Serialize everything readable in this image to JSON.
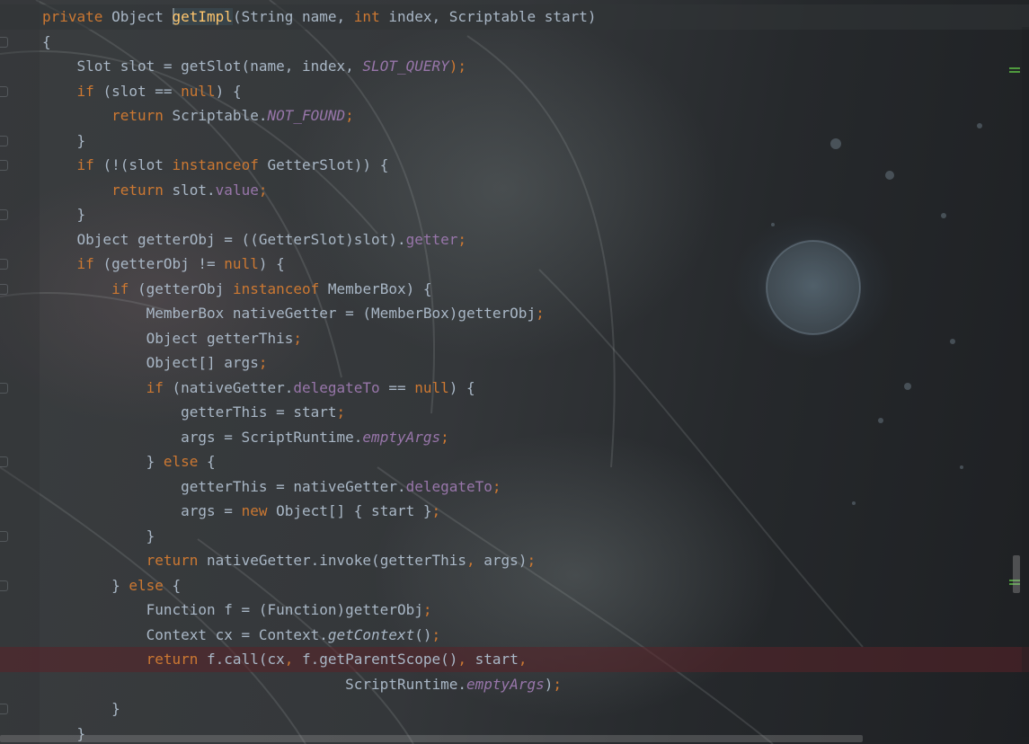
{
  "editor": {
    "lines": [
      {
        "tokens": [
          {
            "t": "private ",
            "c": "kw"
          },
          {
            "t": "Object ",
            "c": ""
          },
          {
            "t": "",
            "c": "caret"
          },
          {
            "t": "getImpl",
            "c": "fn fn-highlight"
          },
          {
            "t": "(String name, ",
            "c": ""
          },
          {
            "t": "int ",
            "c": "kw"
          },
          {
            "t": "index, Scriptable start)",
            "c": ""
          }
        ],
        "state": "current"
      },
      {
        "tokens": [
          {
            "t": "{",
            "c": ""
          }
        ]
      },
      {
        "tokens": [
          {
            "t": "    Slot slot = getSlot(name, index, ",
            "c": ""
          },
          {
            "t": "SLOT_QUERY",
            "c": "sfld"
          },
          {
            "t": ");",
            "c": "kw"
          }
        ]
      },
      {
        "tokens": [
          {
            "t": "    ",
            "c": ""
          },
          {
            "t": "if ",
            "c": "kw"
          },
          {
            "t": "(slot == ",
            "c": ""
          },
          {
            "t": "null",
            "c": "kw"
          },
          {
            "t": ") {",
            "c": ""
          }
        ]
      },
      {
        "tokens": [
          {
            "t": "        ",
            "c": ""
          },
          {
            "t": "return ",
            "c": "kw"
          },
          {
            "t": "Scriptable.",
            "c": ""
          },
          {
            "t": "NOT_FOUND",
            "c": "sfld"
          },
          {
            "t": ";",
            "c": "kw"
          }
        ]
      },
      {
        "tokens": [
          {
            "t": "    }",
            "c": ""
          }
        ]
      },
      {
        "tokens": [
          {
            "t": "    ",
            "c": ""
          },
          {
            "t": "if ",
            "c": "kw"
          },
          {
            "t": "(!(slot ",
            "c": ""
          },
          {
            "t": "instanceof ",
            "c": "kw"
          },
          {
            "t": "GetterSlot)) {",
            "c": ""
          }
        ]
      },
      {
        "tokens": [
          {
            "t": "        ",
            "c": ""
          },
          {
            "t": "return ",
            "c": "kw"
          },
          {
            "t": "slot.",
            "c": ""
          },
          {
            "t": "value",
            "c": "fld"
          },
          {
            "t": ";",
            "c": "kw"
          }
        ]
      },
      {
        "tokens": [
          {
            "t": "    }",
            "c": ""
          }
        ]
      },
      {
        "tokens": [
          {
            "t": "    Object getterObj = ((GetterSlot)slot).",
            "c": ""
          },
          {
            "t": "getter",
            "c": "fld"
          },
          {
            "t": ";",
            "c": "kw"
          }
        ]
      },
      {
        "tokens": [
          {
            "t": "    ",
            "c": ""
          },
          {
            "t": "if ",
            "c": "kw"
          },
          {
            "t": "(getterObj != ",
            "c": ""
          },
          {
            "t": "null",
            "c": "kw"
          },
          {
            "t": ") {",
            "c": ""
          }
        ]
      },
      {
        "tokens": [
          {
            "t": "        ",
            "c": ""
          },
          {
            "t": "if ",
            "c": "kw"
          },
          {
            "t": "(getterObj ",
            "c": ""
          },
          {
            "t": "instanceof ",
            "c": "kw"
          },
          {
            "t": "MemberBox) {",
            "c": ""
          }
        ]
      },
      {
        "tokens": [
          {
            "t": "            MemberBox nativeGetter = (MemberBox)getterObj",
            "c": ""
          },
          {
            "t": ";",
            "c": "kw"
          }
        ]
      },
      {
        "tokens": [
          {
            "t": "            Object getterThis",
            "c": ""
          },
          {
            "t": ";",
            "c": "kw"
          }
        ]
      },
      {
        "tokens": [
          {
            "t": "            Object[] args",
            "c": ""
          },
          {
            "t": ";",
            "c": "kw"
          }
        ]
      },
      {
        "tokens": [
          {
            "t": "            ",
            "c": ""
          },
          {
            "t": "if ",
            "c": "kw"
          },
          {
            "t": "(nativeGetter.",
            "c": ""
          },
          {
            "t": "delegateTo",
            "c": "fld"
          },
          {
            "t": " == ",
            "c": ""
          },
          {
            "t": "null",
            "c": "kw"
          },
          {
            "t": ") {",
            "c": ""
          }
        ]
      },
      {
        "tokens": [
          {
            "t": "                getterThis = start",
            "c": ""
          },
          {
            "t": ";",
            "c": "kw"
          }
        ]
      },
      {
        "tokens": [
          {
            "t": "                args = ScriptRuntime.",
            "c": ""
          },
          {
            "t": "emptyArgs",
            "c": "sfld"
          },
          {
            "t": ";",
            "c": "kw"
          }
        ]
      },
      {
        "tokens": [
          {
            "t": "            } ",
            "c": ""
          },
          {
            "t": "else ",
            "c": "kw"
          },
          {
            "t": "{",
            "c": ""
          }
        ]
      },
      {
        "tokens": [
          {
            "t": "                getterThis = nativeGetter.",
            "c": ""
          },
          {
            "t": "delegateTo",
            "c": "fld"
          },
          {
            "t": ";",
            "c": "kw"
          }
        ]
      },
      {
        "tokens": [
          {
            "t": "                args = ",
            "c": ""
          },
          {
            "t": "new ",
            "c": "kw"
          },
          {
            "t": "Object[] { start }",
            "c": ""
          },
          {
            "t": ";",
            "c": "kw"
          }
        ]
      },
      {
        "tokens": [
          {
            "t": "            }",
            "c": ""
          }
        ]
      },
      {
        "tokens": [
          {
            "t": "            ",
            "c": ""
          },
          {
            "t": "return ",
            "c": "kw"
          },
          {
            "t": "nativeGetter.invoke(getterThis",
            "c": ""
          },
          {
            "t": ", ",
            "c": "kw"
          },
          {
            "t": "args)",
            "c": ""
          },
          {
            "t": ";",
            "c": "kw"
          }
        ]
      },
      {
        "tokens": [
          {
            "t": "        } ",
            "c": ""
          },
          {
            "t": "else ",
            "c": "kw"
          },
          {
            "t": "{",
            "c": ""
          }
        ]
      },
      {
        "tokens": [
          {
            "t": "            Function f = (Function)getterObj",
            "c": ""
          },
          {
            "t": ";",
            "c": "kw"
          }
        ]
      },
      {
        "tokens": [
          {
            "t": "            Context cx = Context.",
            "c": ""
          },
          {
            "t": "getContext",
            "c": "smeth"
          },
          {
            "t": "()",
            "c": ""
          },
          {
            "t": ";",
            "c": "kw"
          }
        ]
      },
      {
        "tokens": [
          {
            "t": "            ",
            "c": ""
          },
          {
            "t": "return ",
            "c": "kw"
          },
          {
            "t": "f.call(cx",
            "c": ""
          },
          {
            "t": ", ",
            "c": "kw"
          },
          {
            "t": "f.getParentScope()",
            "c": ""
          },
          {
            "t": ", ",
            "c": "kw"
          },
          {
            "t": "start",
            "c": ""
          },
          {
            "t": ",",
            "c": "kw"
          }
        ],
        "state": "breakpoint"
      },
      {
        "tokens": [
          {
            "t": "                                   ScriptRuntime.",
            "c": ""
          },
          {
            "t": "emptyArgs",
            "c": "sfld"
          },
          {
            "t": ")",
            "c": ""
          },
          {
            "t": ";",
            "c": "kw"
          }
        ]
      },
      {
        "tokens": [
          {
            "t": "        }",
            "c": ""
          }
        ]
      },
      {
        "tokens": [
          {
            "t": "    }",
            "c": ""
          }
        ]
      }
    ]
  },
  "colors": {
    "keyword": "#cc7832",
    "method_decl": "#ffc66d",
    "field": "#9876aa",
    "plain": "#a9b7c6",
    "change_marker": "#4f9a3e"
  }
}
